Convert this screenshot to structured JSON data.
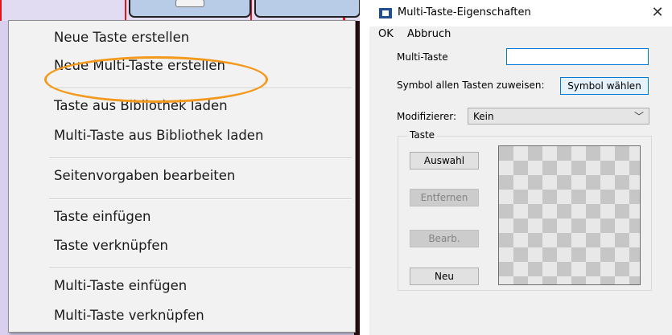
{
  "context_menu": {
    "items": [
      "Neue Taste erstellen",
      "Neue Multi-Taste erstellen",
      "Taste aus Bibliothek laden",
      "Multi-Taste aus Bibliothek laden",
      "Seitenvorgaben bearbeiten",
      "Taste einfügen",
      "Taste verknüpfen",
      "Multi-Taste einfügen",
      "Multi-Taste verknüpfen"
    ],
    "highlight_color": "#f39a1e"
  },
  "dialog": {
    "title": "Multi-Taste-Eigenschaften",
    "close": "✕",
    "menu": {
      "ok": "OK",
      "cancel": "Abbruch"
    },
    "multi_taste_label": "Multi-Taste",
    "multi_taste_value": "",
    "symbol_label": "Symbol allen Tasten zuweisen:",
    "symbol_button": "Symbol wählen",
    "modifier_label": "Modifizierer:",
    "modifier_value": "Kein",
    "group_label": "Taste",
    "buttons": {
      "select": "Auswahl",
      "remove": "Entfernen",
      "edit": "Bearb.",
      "new": "Neu"
    },
    "accent_color": "#0078d7"
  }
}
